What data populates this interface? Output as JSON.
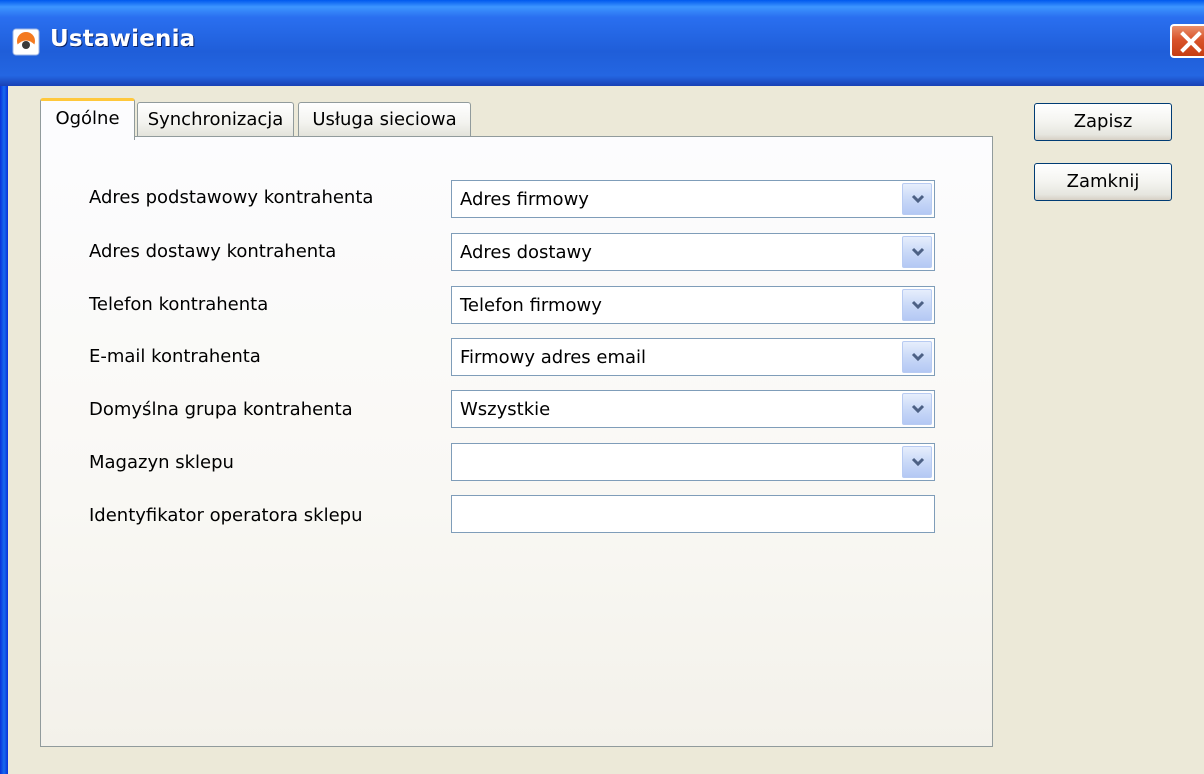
{
  "window": {
    "title": "Ustawienia"
  },
  "tabs": [
    {
      "label": "Ogólne",
      "active": true
    },
    {
      "label": "Synchronizacja",
      "active": false
    },
    {
      "label": "Usługa sieciowa",
      "active": false
    }
  ],
  "fields": [
    {
      "label": "Adres podstawowy kontrahenta",
      "type": "combo",
      "value": "Adres firmowy"
    },
    {
      "label": "Adres dostawy kontrahenta",
      "type": "combo",
      "value": "Adres dostawy"
    },
    {
      "label": "Telefon kontrahenta",
      "type": "combo",
      "value": "Telefon firmowy"
    },
    {
      "label": "E-mail kontrahenta",
      "type": "combo",
      "value": "Firmowy adres email"
    },
    {
      "label": "Domyślna grupa kontrahenta",
      "type": "combo",
      "value": "Wszystkie"
    },
    {
      "label": "Magazyn sklepu",
      "type": "combo",
      "value": ""
    },
    {
      "label": "Identyfikator operatora sklepu",
      "type": "text",
      "value": ""
    }
  ],
  "buttons": {
    "save": "Zapisz",
    "close": "Zamknij"
  },
  "icons": {
    "app": "app-logo-icon",
    "close": "close-icon",
    "dropdown": "chevron-down-icon"
  },
  "colors": {
    "titlebar": "#2466e2",
    "active_tab_accent": "#ffc83c",
    "close_button": "#d9542b"
  }
}
